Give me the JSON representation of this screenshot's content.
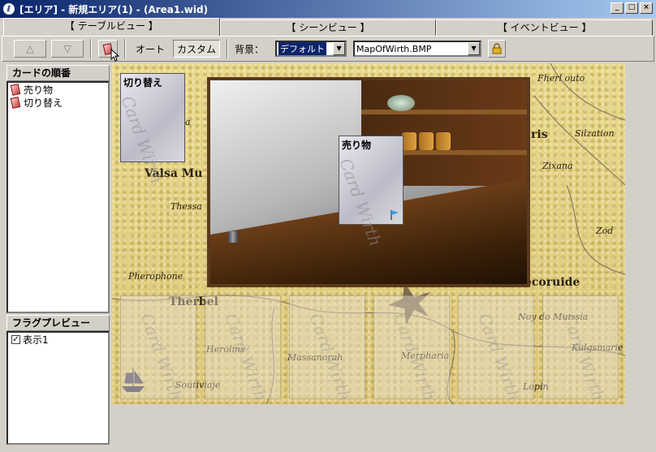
{
  "window": {
    "title": "[エリア] - 新規エリア(1) - (Area1.wid)",
    "controls": {
      "minimize": "_",
      "maximize": "□",
      "close": "×"
    }
  },
  "tabs": [
    {
      "label": "【 テーブルビュー 】",
      "active": true
    },
    {
      "label": "【 シーンビュー 】",
      "active": false
    },
    {
      "label": "【 イベントビュー 】",
      "active": false
    }
  ],
  "toolbar": {
    "up": "△",
    "down": "▽",
    "auto_label": "オート",
    "custom_label": "カスタム",
    "bg_label": "背景：",
    "bg_select": "デフォルト",
    "bg_file": "MapOfWirth.BMP"
  },
  "card_order": {
    "title": "カードの順番",
    "items": [
      "売り物",
      "切り替え"
    ]
  },
  "flag_preview": {
    "title": "フラグプレビュー",
    "items": [
      {
        "label": "表示1",
        "checked": true
      }
    ]
  },
  "canvas": {
    "card_switch": "切り替え",
    "card_sell": "売り物",
    "watermark": "Card Wirth",
    "map_labels": [
      "Fherl outo",
      "Valsa Mu",
      "Thessa",
      "ris",
      "Silzation",
      "Zixana",
      "Zod",
      "Pherophone",
      "Therbel",
      "Herolms",
      "Massanorah",
      "Merpharia",
      "Soutiviaje",
      "Noy do Muissia",
      "Kulgsmarie",
      "Lopin",
      "ecoruide",
      "a"
    ]
  },
  "colors": {
    "titlebar_start": "#0a246a",
    "titlebar_end": "#a6caf0",
    "map_parchment": "#e2cf7e",
    "frame_wood": "#5a3a1a"
  }
}
